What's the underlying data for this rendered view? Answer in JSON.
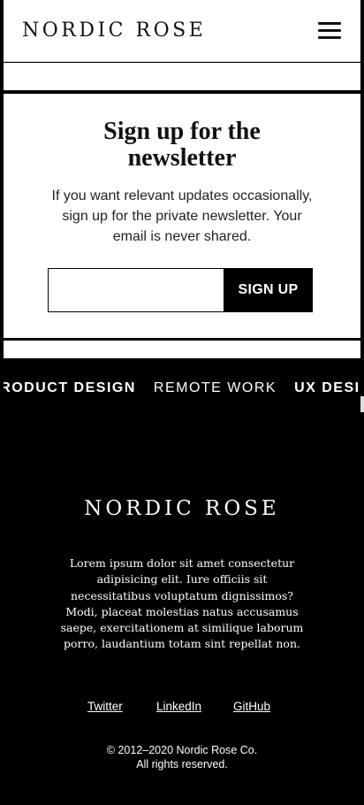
{
  "header": {
    "logo": "NORDIC ROSE",
    "menu_icon": "hamburger-menu-icon"
  },
  "newsletter": {
    "title_line1": "Sign up for the",
    "title_line2": "newsletter",
    "description": "If you want relevant updates occasionally, sign up for the private newsletter. Your email is never shared.",
    "email_value": "",
    "email_placeholder": "",
    "button_label": "SIGN UP"
  },
  "ticker": {
    "items": [
      "PRODUCT DESIGN",
      "REMOTE WORK",
      "UX DESIGN"
    ]
  },
  "footer": {
    "logo": "NORDIC ROSE",
    "text": "Lorem ipsum dolor sit amet consectetur adipisicing elit. Iure officiis sit necessitatibus voluptatum dignissimos? Modi, placeat molestias natus accusamus saepe, exercitationem at similique laborum porro, laudantium totam sint repellat non.",
    "links": [
      "Twitter",
      "LinkedIn",
      "GitHub"
    ],
    "copyright_line1": "© 2012–2020 Nordic Rose Co.",
    "copyright_line2": "All rights reserved."
  },
  "colors": {
    "background": "#000000",
    "surface": "#ffffff",
    "text": "#111111"
  }
}
